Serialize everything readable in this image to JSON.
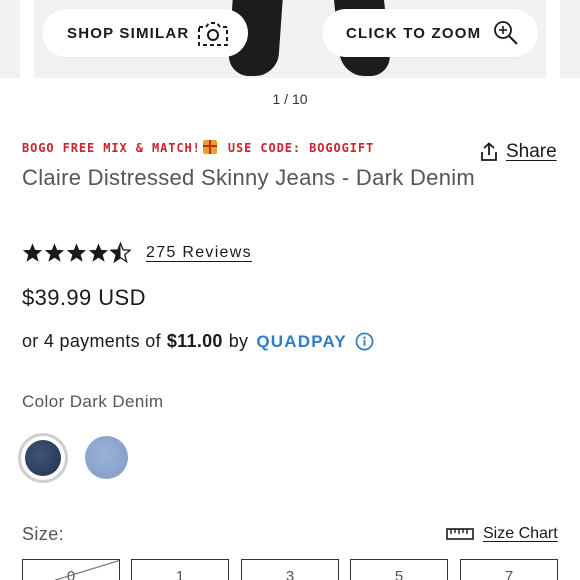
{
  "gallery": {
    "shop_similar_label": "SHOP SIMILAR",
    "click_zoom_label": "CLICK TO ZOOM",
    "counter": "1 / 10"
  },
  "product": {
    "promo_prefix": "BOGO FREE MIX & MATCH!",
    "promo_suffix": " USE CODE: BOGOGIFT",
    "share_label": "Share",
    "title": "Claire Distressed Skinny Jeans - Dark Denim",
    "rating": 4.5,
    "reviews_label": "275 Reviews",
    "price": "$39.99 USD",
    "installments": {
      "prefix": "or 4 payments of",
      "amount": "$11.00",
      "by": "by",
      "provider": "QUADPAY"
    },
    "color": {
      "label": "Color Dark Denim",
      "swatches": [
        {
          "name": "Dark Denim",
          "color": "#2f4060",
          "selected": true
        },
        {
          "name": "Light Denim",
          "color": "#8ea8cf",
          "selected": false
        }
      ]
    },
    "size": {
      "label": "Size:",
      "chart_label": "Size Chart",
      "options": [
        {
          "label": "0",
          "available": false
        },
        {
          "label": "1",
          "available": true
        },
        {
          "label": "3",
          "available": true
        },
        {
          "label": "5",
          "available": true
        },
        {
          "label": "7",
          "available": true
        }
      ]
    }
  },
  "colors": {
    "promo_red": "#c8262b",
    "quadpay_blue": "#2d7ec4",
    "text_dark": "#1a1a1a",
    "text_muted": "#555555"
  }
}
